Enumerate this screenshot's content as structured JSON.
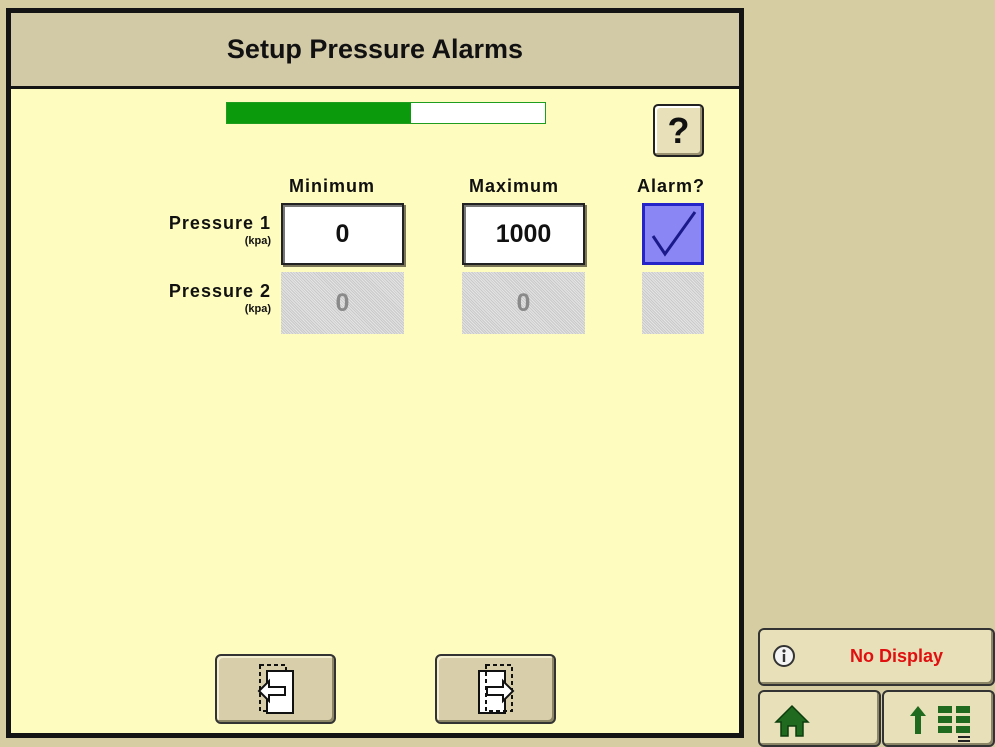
{
  "title": "Setup Pressure Alarms",
  "progress": 0.58,
  "help_label": "?",
  "columns": {
    "minimum": "Minimum",
    "maximum": "Maximum",
    "alarm": "Alarm?"
  },
  "rows": [
    {
      "label": "Pressure 1",
      "unit": "(kpa)",
      "min": "0",
      "max": "1000",
      "alarm_checked": true,
      "enabled": true
    },
    {
      "label": "Pressure 2",
      "unit": "(kpa)",
      "min": "0",
      "max": "0",
      "alarm_checked": false,
      "enabled": false
    }
  ],
  "nav": {
    "prev_icon": "page-back-icon",
    "next_icon": "page-forward-icon"
  },
  "status": {
    "icon": "info-icon",
    "text": "No Display"
  },
  "softkeys": {
    "home_icon": "home-icon",
    "menu_icon": "menu-up-icon"
  },
  "colors": {
    "panel_bg": "#fffcbf",
    "title_bg": "#d2c9a7",
    "progress_fill": "#0b9a0b",
    "checkbox_checked": "#8a86f4",
    "status_text": "#e01010",
    "home_icon": "#1f6a1f"
  }
}
